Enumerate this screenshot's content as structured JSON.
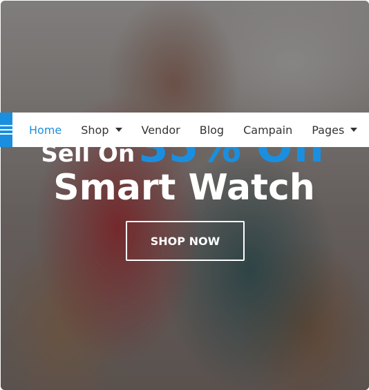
{
  "nav": {
    "items": [
      {
        "label": "Home",
        "active": true
      },
      {
        "label": "Shop",
        "dropdown": true
      },
      {
        "label": "Vendor"
      },
      {
        "label": "Blog"
      },
      {
        "label": "Campain"
      },
      {
        "label": "Pages",
        "dropdown": true
      }
    ],
    "menu_icon": "hamburger-menu-icon",
    "accent_color": "#1a8fe0"
  },
  "hero": {
    "kicker_prefix": "Sell On",
    "kicker_highlight": "35% Off",
    "headline": "Smart Watch",
    "cta_label": "SHOP NOW",
    "highlight_color": "#1a8fe0"
  }
}
